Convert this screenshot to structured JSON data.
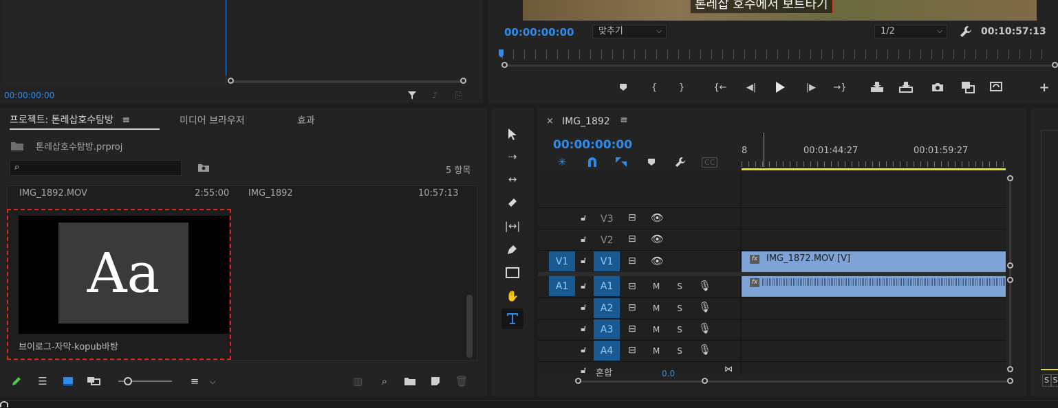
{
  "source_monitor": {
    "timecode": "00:00:00:00"
  },
  "program_monitor": {
    "subtitle": "톤레삽 호수에서 보트타기",
    "timecode": "00:00:00:00",
    "fit_select": "맞추기",
    "resolution_select": "1/2",
    "duration": "00:10:57:13"
  },
  "project_panel": {
    "tabs": [
      {
        "label": "프로젝트: 톤레삽호수탐방"
      },
      {
        "label": "미디어 브라우저"
      },
      {
        "label": "효과"
      }
    ],
    "file_name": "톤레삽호수탐방.prproj",
    "search_placeholder": "",
    "item_count": "5 항목",
    "list_row": {
      "name": "IMG_1892.MOV",
      "duration": "2:55:00",
      "sequence": "IMG_1892",
      "end": "10:57:13"
    },
    "thumb": {
      "preview_text": "Aa",
      "label": "브이로그-자막-kopub바탕"
    }
  },
  "timeline": {
    "sequence_name": "IMG_1892",
    "timecode": "00:00:00:00",
    "ruler_labels": [
      "8",
      "00:01:44:27",
      "00:01:59:27"
    ],
    "cc_label": "CC",
    "video_tracks": [
      {
        "source": "",
        "name": "V3"
      },
      {
        "source": "",
        "name": "V2"
      },
      {
        "source": "V1",
        "name": "V1"
      }
    ],
    "audio_tracks": [
      {
        "source": "A1",
        "name": "A1"
      },
      {
        "source": "",
        "name": "A2"
      },
      {
        "source": "",
        "name": "A3"
      },
      {
        "source": "",
        "name": "A4"
      }
    ],
    "mute_label": "M",
    "solo_label": "S",
    "mix_label": "혼합",
    "mix_value": "0.0",
    "video_clip": "IMG_1872.MOV [V]",
    "fx_label": "fx"
  },
  "right_panel": {
    "s_labels": [
      "S",
      "S"
    ]
  },
  "colors": {
    "accent_blue": "#2d8ceb",
    "clip_blue": "#7ea4d6",
    "track_target": "#1a5a93",
    "selection_red": "#e0261b",
    "playhead_yellow": "#e6e21c"
  }
}
